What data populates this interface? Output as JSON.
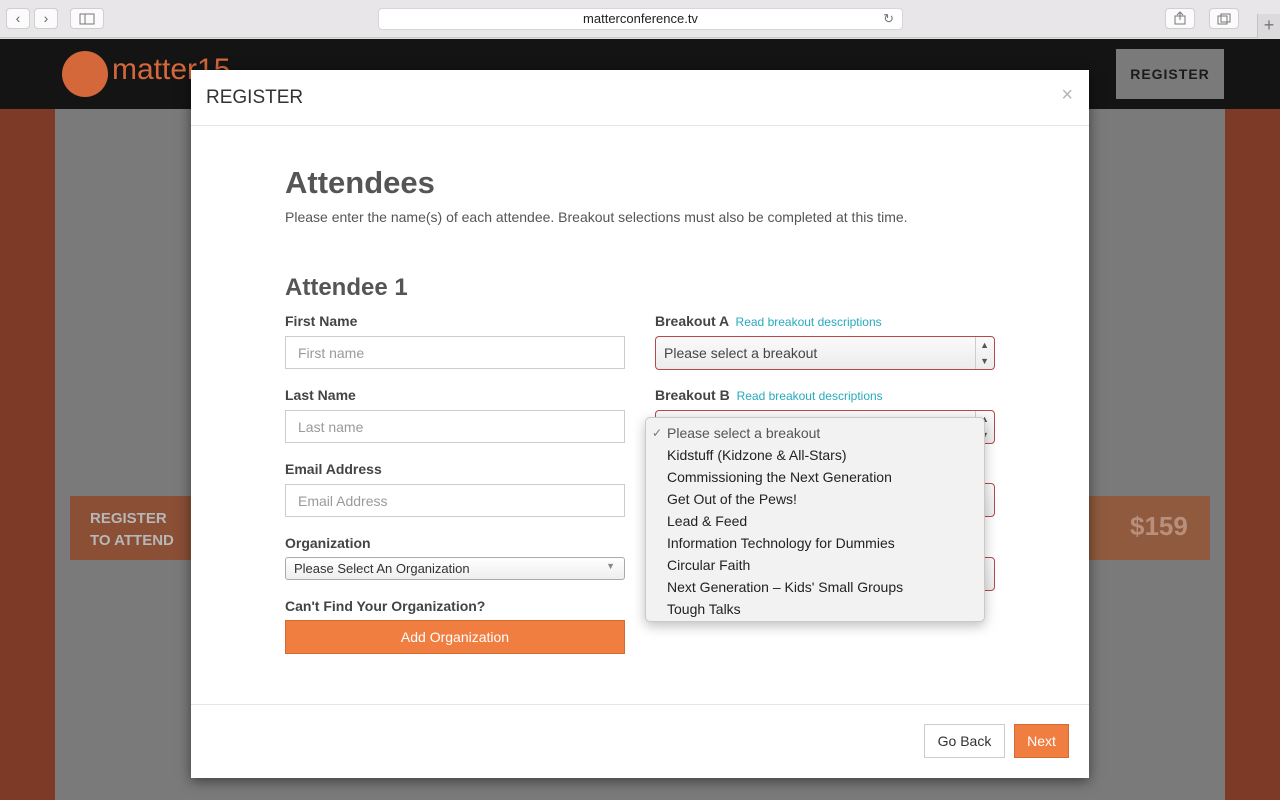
{
  "browser": {
    "url": "matterconference.tv",
    "back_icon": "‹",
    "forward_icon": "›",
    "reload_icon": "↻",
    "new_tab_icon": "+"
  },
  "site": {
    "logo_text": "matter15",
    "nav_register": "REGISTER",
    "banner_left": "REGISTER TO ATTEND",
    "price": "$159"
  },
  "modal": {
    "title": "REGISTER",
    "close": "×",
    "section_title": "Attendees",
    "section_desc": "Please enter the name(s) of each attendee. Breakout selections must also be completed at this time.",
    "attendee_title": "Attendee 1",
    "first_name": {
      "label": "First Name",
      "placeholder": "First name"
    },
    "last_name": {
      "label": "Last Name",
      "placeholder": "Last name"
    },
    "email": {
      "label": "Email Address",
      "placeholder": "Email Address"
    },
    "organization": {
      "label": "Organization",
      "selected": "Please Select An Organization"
    },
    "cant_find": "Can't Find Your Organization?",
    "add_org": "Add Organization",
    "breakout_a": {
      "label": "Breakout A",
      "link": "Read breakout descriptions",
      "selected": "Please select a breakout"
    },
    "breakout_b": {
      "label": "Breakout B",
      "link": "Read breakout descriptions"
    },
    "go_back": "Go Back",
    "next": "Next"
  },
  "dropdown": {
    "items": [
      "Please select a breakout",
      "Kidstuff (Kidzone & All-Stars)",
      "Commissioning the Next Generation",
      "Get Out of the Pews!",
      "Lead & Feed",
      "Information Technology for Dummies",
      "Circular Faith",
      "Next Generation – Kids' Small Groups",
      "Tough Talks"
    ],
    "selected_index": 0
  },
  "colors": {
    "accent": "#f07e40",
    "link": "#27aabd",
    "error_border": "#b44a4a"
  }
}
